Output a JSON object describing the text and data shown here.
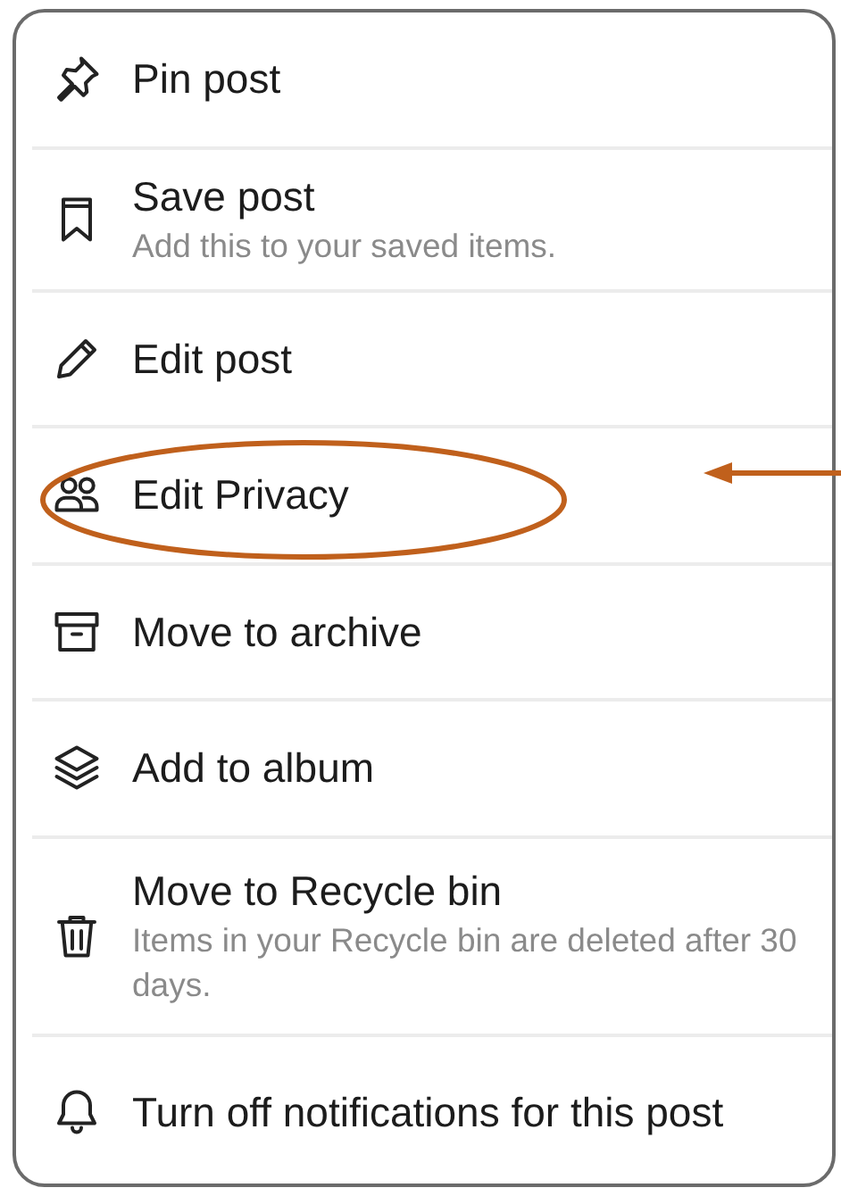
{
  "menu": {
    "items": [
      {
        "label": "Pin post",
        "highlighted": false
      },
      {
        "label": "Save post",
        "description": "Add this to your saved items.",
        "highlighted": false
      },
      {
        "label": "Edit post",
        "highlighted": false
      },
      {
        "label": "Edit Privacy",
        "highlighted": true
      },
      {
        "label": "Move to archive",
        "highlighted": false
      },
      {
        "label": "Add to album",
        "highlighted": false
      },
      {
        "label": "Move to Recycle bin",
        "description": "Items in your Recycle bin are deleted after 30 days.",
        "highlighted": false
      },
      {
        "label": "Turn off notifications for this post",
        "highlighted": false
      }
    ]
  }
}
